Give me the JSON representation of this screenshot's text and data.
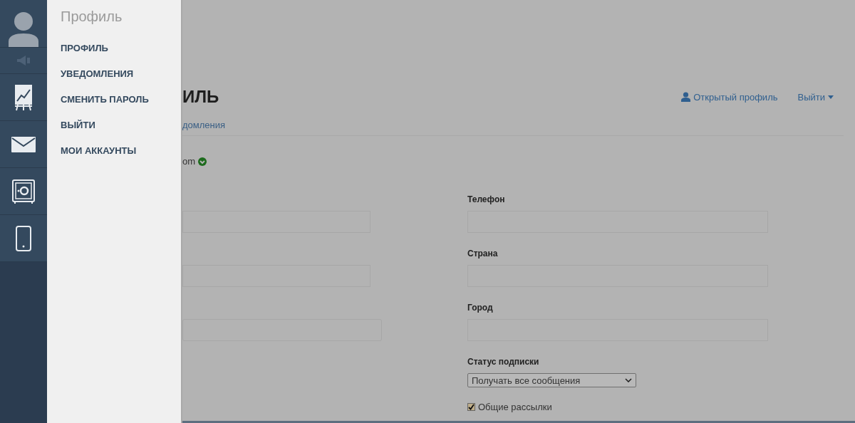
{
  "rail": {
    "items": [
      {
        "kind": "avatar"
      },
      {
        "kind": "speaker"
      },
      {
        "kind": "chart"
      },
      {
        "kind": "mail"
      },
      {
        "kind": "safe"
      },
      {
        "kind": "phone"
      }
    ]
  },
  "drawer": {
    "title": "Профиль",
    "items": [
      {
        "label": "ПРОФИЛЬ"
      },
      {
        "label": "УВЕДОМЛЕНИЯ"
      },
      {
        "label": "СМЕНИТЬ ПАРОЛЬ"
      },
      {
        "label": "ВЫЙТИ"
      },
      {
        "label": "МОИ АККАУНТЫ"
      }
    ]
  },
  "page": {
    "title": "ИЛЬ",
    "header_links": [
      {
        "label": "Открытый профиль",
        "kind": "profile"
      },
      {
        "label": "Выйти",
        "kind": "dropdown"
      }
    ],
    "tabs": [
      {
        "label": "домления"
      }
    ],
    "email": {
      "text": "om",
      "verified": true
    },
    "left_fields": [
      {
        "kind": "text"
      },
      {
        "kind": "text"
      },
      {
        "kind": "wide"
      }
    ],
    "right_fields": [
      {
        "label": "Телефон",
        "kind": "text"
      },
      {
        "label": "Страна",
        "kind": "text"
      },
      {
        "label": "Город",
        "kind": "text"
      },
      {
        "label": "Статус подписки",
        "kind": "select",
        "value": "Получать все сообщения"
      }
    ],
    "checkbox": {
      "label": "Общие рассылки",
      "checked": true
    }
  }
}
